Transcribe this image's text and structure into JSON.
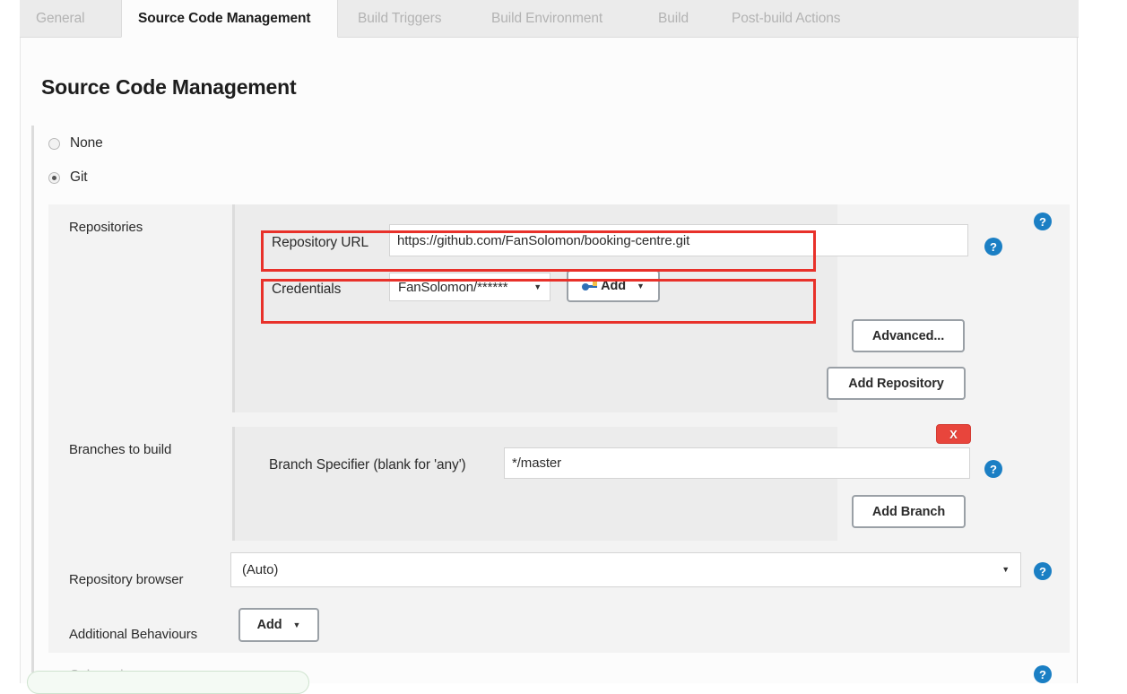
{
  "tabs": [
    {
      "label": "General",
      "active": false
    },
    {
      "label": "Source Code Management",
      "active": true
    },
    {
      "label": "Build Triggers",
      "active": false
    },
    {
      "label": "Build Environment",
      "active": false
    },
    {
      "label": "Build",
      "active": false
    },
    {
      "label": "Post-build Actions",
      "active": false
    }
  ],
  "page": {
    "title": "Source Code Management"
  },
  "scm_options": [
    {
      "label": "None",
      "selected": false
    },
    {
      "label": "Git",
      "selected": true
    },
    {
      "label": "Subversion",
      "selected": false
    }
  ],
  "git": {
    "repositories": {
      "section_label": "Repositories",
      "repository_url": {
        "label": "Repository URL",
        "value": "https://github.com/FanSolomon/booking-centre.git"
      },
      "credentials": {
        "label": "Credentials",
        "selected": "FanSolomon/******",
        "add_button": "Add",
        "add_icon": "key-icon",
        "caret_icon": "chevron-down-icon"
      },
      "advanced_button": "Advanced...",
      "add_repository_button": "Add Repository"
    },
    "branches": {
      "section_label": "Branches to build",
      "branch_specifier": {
        "label": "Branch Specifier (blank for 'any')",
        "value": "*/master"
      },
      "delete_button": "X",
      "add_branch_button": "Add Branch"
    },
    "repository_browser": {
      "label": "Repository browser",
      "selected": "(Auto)",
      "caret_icon": "chevron-down-icon"
    },
    "additional_behaviours": {
      "label": "Additional Behaviours",
      "add_button": "Add",
      "caret_icon": "chevron-down-icon"
    }
  },
  "help": {
    "glyph": "?"
  },
  "colors": {
    "annotation_red": "#e8312a",
    "help_blue": "#1b7fc4",
    "delete_red": "#e8453c",
    "tab_active_text": "#1d1d1d",
    "tab_inactive_text": "#b3b3b3"
  }
}
